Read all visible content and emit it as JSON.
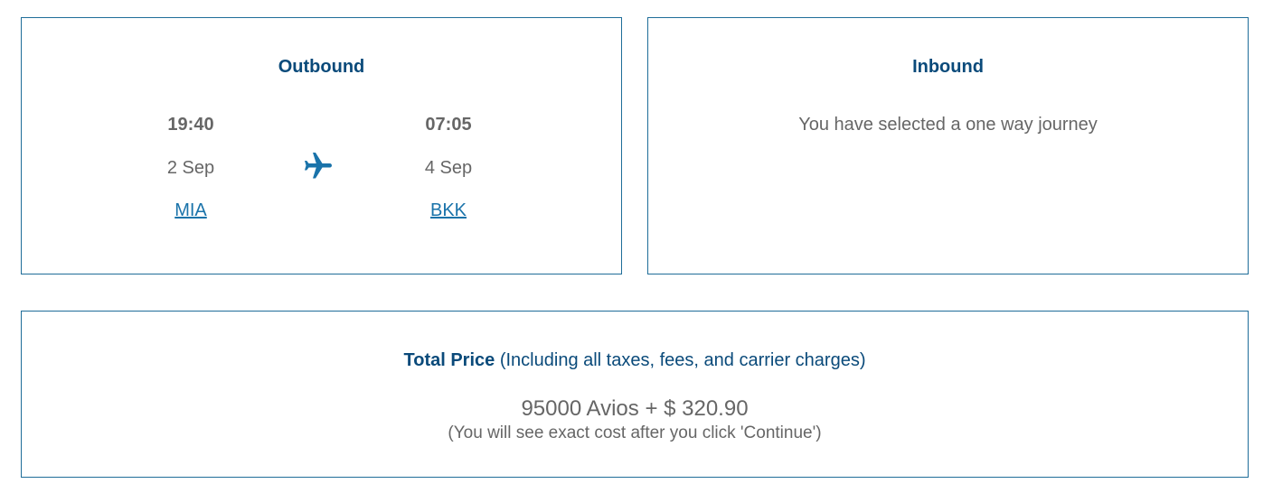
{
  "outbound": {
    "title": "Outbound",
    "departure": {
      "time": "19:40",
      "date": "2 Sep",
      "airport": "MIA"
    },
    "arrival": {
      "time": "07:05",
      "date": "4 Sep",
      "airport": "BKK"
    },
    "icon": "airplane-icon",
    "accent_color": "#1a73aa"
  },
  "inbound": {
    "title": "Inbound",
    "message": "You have selected a one way journey"
  },
  "price": {
    "label": "Total Price",
    "label_note": "(Including all taxes, fees, and carrier charges)",
    "amount": "95000 Avios + $ 320.90",
    "note": "(You will see exact cost after you click 'Continue')"
  },
  "colors": {
    "border": "#1f6d99",
    "heading": "#0a4a7a",
    "link": "#1a73aa",
    "text": "#666666"
  }
}
